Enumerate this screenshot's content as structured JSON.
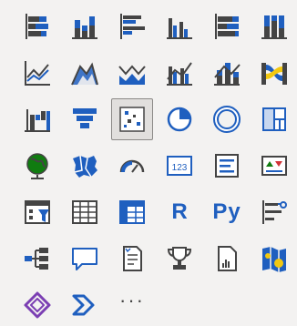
{
  "visualizations": {
    "selected": "scatter-chart",
    "tiles": [
      {
        "name": "stacked-bar-chart-icon"
      },
      {
        "name": "stacked-column-chart-icon"
      },
      {
        "name": "clustered-bar-chart-icon"
      },
      {
        "name": "clustered-column-chart-icon"
      },
      {
        "name": "100-stacked-bar-chart-icon"
      },
      {
        "name": "100-stacked-column-chart-icon"
      },
      {
        "name": "line-chart-icon"
      },
      {
        "name": "area-chart-icon"
      },
      {
        "name": "stacked-area-chart-icon"
      },
      {
        "name": "line-clustered-column-chart-icon"
      },
      {
        "name": "line-stacked-column-chart-icon"
      },
      {
        "name": "ribbon-chart-icon"
      },
      {
        "name": "waterfall-chart-icon"
      },
      {
        "name": "funnel-chart-icon"
      },
      {
        "name": "scatter-chart-icon"
      },
      {
        "name": "pie-chart-icon"
      },
      {
        "name": "donut-chart-icon"
      },
      {
        "name": "treemap-icon"
      },
      {
        "name": "map-icon"
      },
      {
        "name": "filled-map-icon"
      },
      {
        "name": "gauge-icon"
      },
      {
        "name": "card-icon"
      },
      {
        "name": "multi-row-card-icon"
      },
      {
        "name": "kpi-icon"
      },
      {
        "name": "slicer-icon"
      },
      {
        "name": "table-icon"
      },
      {
        "name": "matrix-icon"
      },
      {
        "name": "r-script-visual-icon",
        "text": "R"
      },
      {
        "name": "python-visual-icon",
        "text": "Py"
      },
      {
        "name": "key-influencers-icon"
      },
      {
        "name": "decomposition-tree-icon"
      },
      {
        "name": "q-and-a-icon"
      },
      {
        "name": "smart-narrative-icon"
      },
      {
        "name": "goals-icon"
      },
      {
        "name": "paginated-report-icon"
      },
      {
        "name": "arcgis-map-icon"
      },
      {
        "name": "power-apps-icon"
      },
      {
        "name": "power-automate-icon"
      },
      {
        "name": "more-visuals-icon",
        "text": "···"
      }
    ],
    "card_text": "123",
    "colors": {
      "blue": "#1f5fbf",
      "dark": "#444444",
      "yellow": "#f2c811",
      "red": "#d13438",
      "green": "#107c10",
      "purple": "#7b3fb3"
    }
  }
}
